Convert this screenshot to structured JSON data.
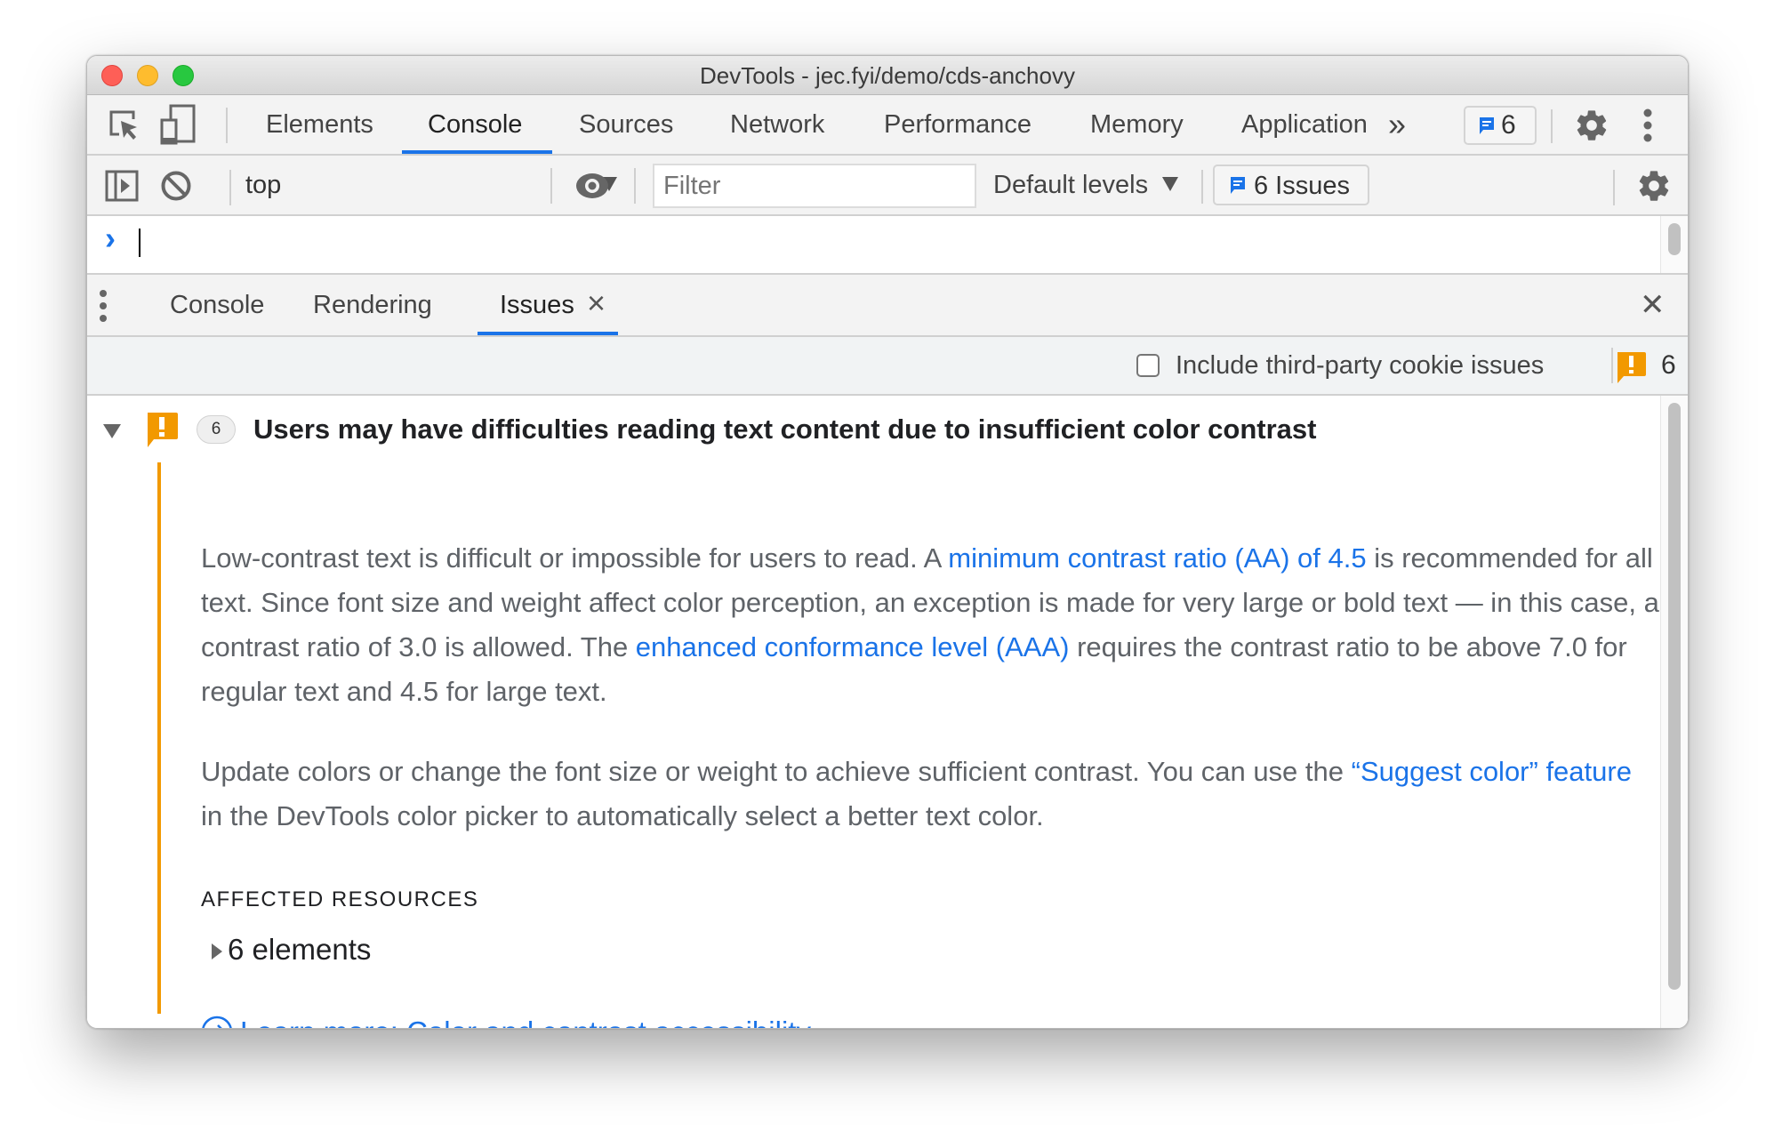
{
  "window": {
    "title": "DevTools - jec.fyi/demo/cds-anchovy"
  },
  "main_toolbar": {
    "tabs": [
      {
        "label": "Elements",
        "active": false
      },
      {
        "label": "Console",
        "active": true
      },
      {
        "label": "Sources",
        "active": false
      },
      {
        "label": "Network",
        "active": false
      },
      {
        "label": "Performance",
        "active": false
      },
      {
        "label": "Memory",
        "active": false
      },
      {
        "label": "Application",
        "active": false
      }
    ],
    "more_tabs_glyph": "»",
    "issues_badge_count": "6"
  },
  "console_toolbar": {
    "context_select": "top",
    "filter_placeholder": "Filter",
    "levels_select": "Default levels",
    "issues_button": "6 Issues"
  },
  "prompt": {
    "glyph": "›"
  },
  "drawer": {
    "tabs": [
      {
        "label": "Console",
        "active": false
      },
      {
        "label": "Rendering",
        "active": false
      },
      {
        "label": "Issues",
        "active": true,
        "closable": true
      }
    ],
    "tab_close_glyph": "×",
    "close_glyph": "✕"
  },
  "issues_toolbar": {
    "checkbox_label": "Include third-party cookie issues",
    "checkbox_checked": false,
    "warning_count": "6"
  },
  "issue": {
    "count": "6",
    "title": "Users may have difficulties reading text content due to insufficient color contrast",
    "para1": {
      "t1": "Low-contrast text is difficult or impossible for users to read. A ",
      "link1": "minimum contrast ratio (AA) of 4.5",
      "t2": " is recommended for all text. Since font size and weight affect color perception, an exception is made for very large or bold text — in this case, a contrast ratio of 3.0 is allowed. The ",
      "link2": "enhanced conformance level (AAA)",
      "t3": " requires the contrast ratio to be above 7.0 for regular text and 4.5 for large text."
    },
    "para2": {
      "t1": "Update colors or change the font size or weight to achieve sufficient contrast. You can use the ",
      "link1": "“Suggest color” feature",
      "t2": " in the DevTools color picker to automatically select a better text color."
    },
    "affected_heading": "AFFECTED RESOURCES",
    "affected_item": "6 elements",
    "learn_more": "Learn more: Color and contrast accessibility"
  },
  "colors": {
    "accent": "#1a73e8",
    "warning": "#f29900"
  }
}
